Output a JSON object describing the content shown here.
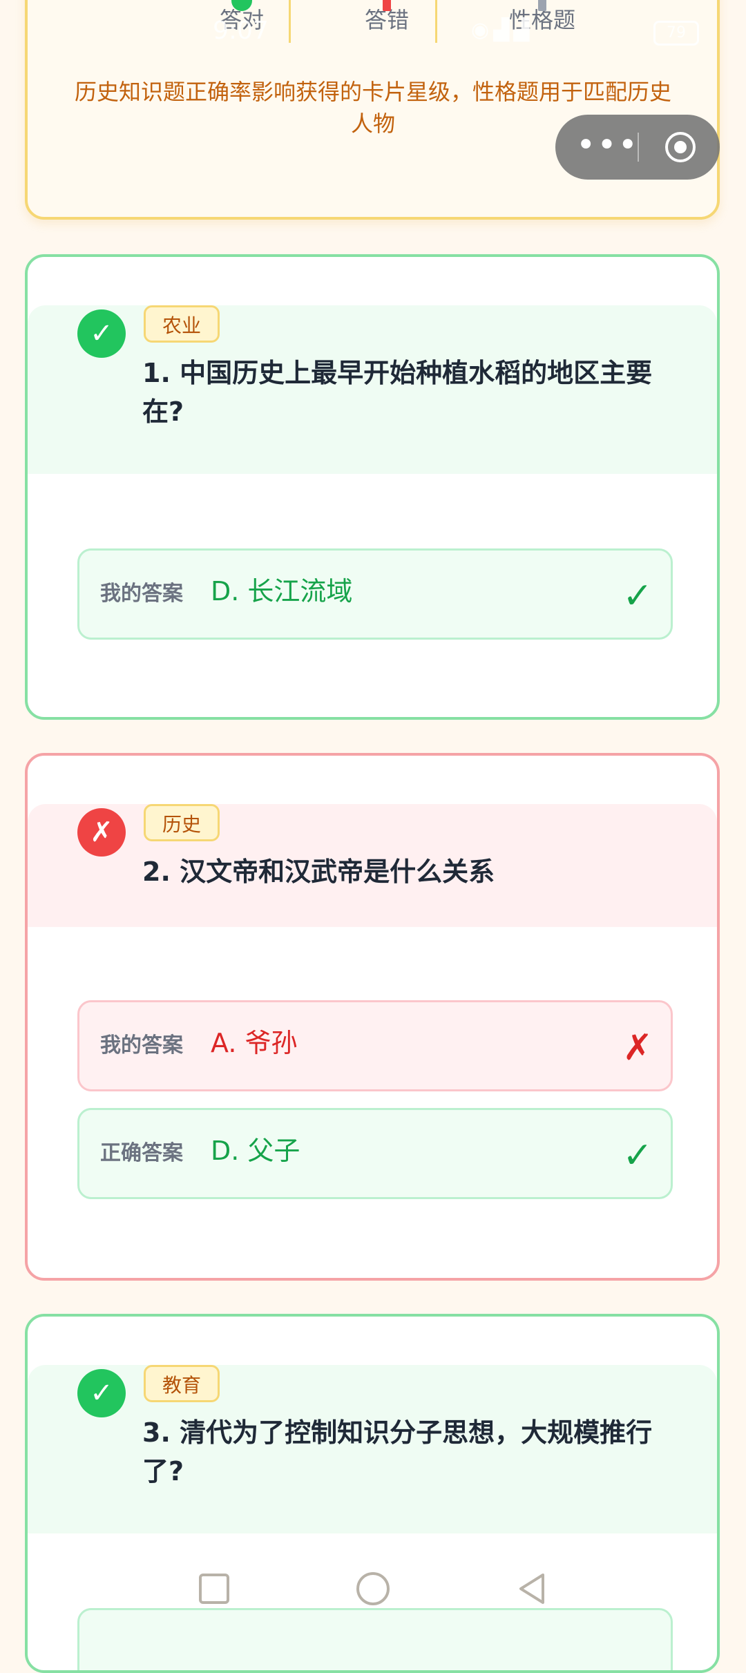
{
  "summary": {
    "stats": [
      {
        "label": "答对"
      },
      {
        "label": "答错"
      },
      {
        "label": "性格题"
      }
    ],
    "note": "历史知识题正确率影响获得的卡片星级，性格题用于匹配历史人物"
  },
  "status_bar": {
    "time": "9:07",
    "battery": "79"
  },
  "capsule": {
    "more_label": "•••",
    "more_icon": "more-dots-icon",
    "close_icon": "target-close-icon"
  },
  "questions": [
    {
      "status": "correct",
      "category": "农业",
      "text": "1. 中国历史上最早开始种植水稻的地区主要在?",
      "answers": [
        {
          "label": "我的答案",
          "value": "D. 长江流域",
          "mark": "✓"
        }
      ]
    },
    {
      "status": "wrong",
      "category": "历史",
      "text": "2. 汉文帝和汉武帝是什么关系",
      "answers": [
        {
          "label": "我的答案",
          "value": "A. 爷孙",
          "mark": "✗"
        },
        {
          "label": "正确答案",
          "value": "D. 父子",
          "mark": "✓"
        }
      ]
    },
    {
      "status": "correct",
      "category": "教育",
      "text": "3. 清代为了控制知识分子思想，大规模推行了?",
      "answers": []
    }
  ],
  "badges": {
    "correct": "✓",
    "wrong": "✗"
  },
  "colors": {
    "correct": "#22c55e",
    "wrong": "#ef4444",
    "accent": "#f6d774",
    "note": "#c2620e"
  }
}
